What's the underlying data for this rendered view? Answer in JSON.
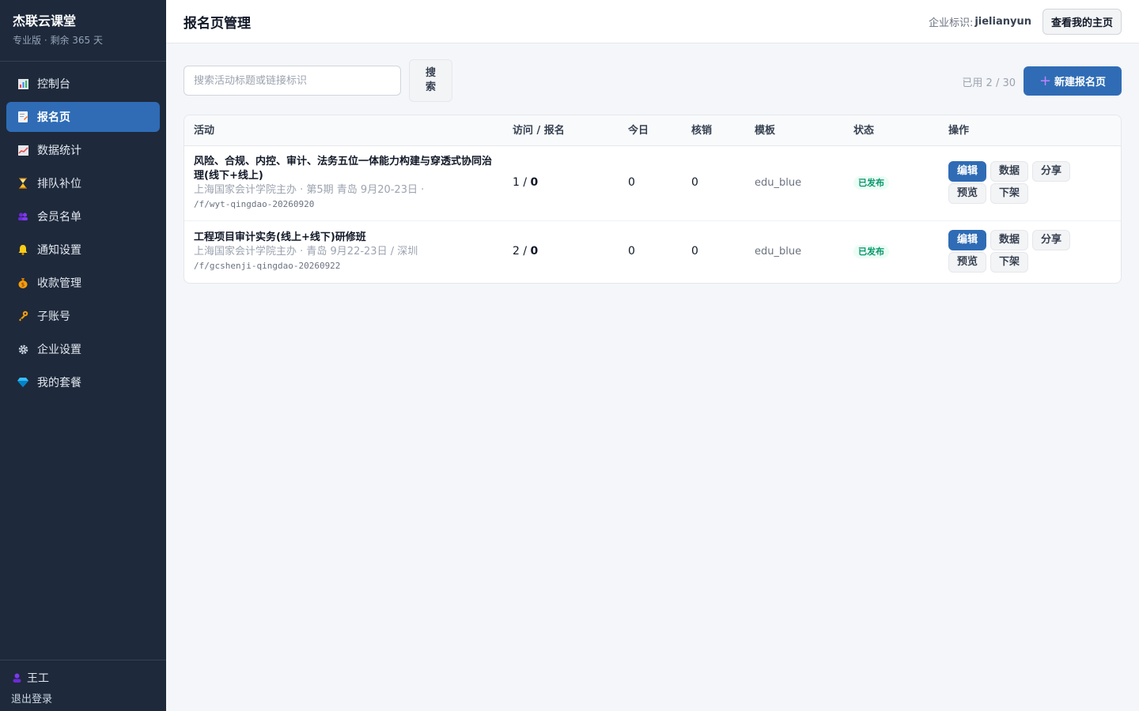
{
  "sidebar": {
    "brand_name": "杰联云课堂",
    "brand_sub": "专业版 · 剩余 365 天",
    "items": [
      {
        "label": "控制台",
        "icon": "bar-chart-icon"
      },
      {
        "label": "报名页",
        "icon": "document-icon",
        "active": true
      },
      {
        "label": "数据统计",
        "icon": "line-chart-icon"
      },
      {
        "label": "排队补位",
        "icon": "hourglass-icon"
      },
      {
        "label": "会员名单",
        "icon": "users-icon"
      },
      {
        "label": "通知设置",
        "icon": "bell-icon"
      },
      {
        "label": "收款管理",
        "icon": "money-bag-icon"
      },
      {
        "label": "子账号",
        "icon": "key-icon"
      },
      {
        "label": "企业设置",
        "icon": "gear-icon"
      },
      {
        "label": "我的套餐",
        "icon": "diamond-icon"
      }
    ],
    "user_name": "王工",
    "logout_label": "退出登录"
  },
  "header": {
    "title": "报名页管理",
    "tenant_label": "企业标识:",
    "tenant_id": "jielianyun",
    "home_button": "查看我的主页"
  },
  "toolbar": {
    "search_placeholder": "搜索活动标题或链接标识",
    "search_button": "搜索",
    "quota": "已用 2 / 30",
    "new_button": "新建报名页"
  },
  "table": {
    "columns": [
      "活动",
      "访问 / 报名",
      "今日",
      "核销",
      "模板",
      "状态",
      "操作"
    ],
    "rows": [
      {
        "title": "风险、合规、内控、审计、法务五位一体能力构建与穿透式协同治理(线下+线上)",
        "meta": "上海国家会计学院主办 · 第5期 青岛 9月20-23日 ·",
        "path": "/f/wyt-qingdao-20260920",
        "visits": "1",
        "signups": "0",
        "today": "0",
        "verified": "0",
        "template": "edu_blue",
        "status": "已发布"
      },
      {
        "title": "工程项目审计实务(线上+线下)研修班",
        "meta": "上海国家会计学院主办 · 青岛 9月22-23日 / 深圳",
        "path": "/f/gcshenji-qingdao-20260922",
        "visits": "2",
        "signups": "0",
        "today": "0",
        "verified": "0",
        "template": "edu_blue",
        "status": "已发布"
      }
    ],
    "actions": {
      "edit": "编辑",
      "data": "数据",
      "share": "分享",
      "preview": "预览",
      "offline": "下架"
    }
  },
  "colors": {
    "sidebar_bg": "#1e293b",
    "accent": "#2f6cb5",
    "published_badge": "#059669"
  }
}
